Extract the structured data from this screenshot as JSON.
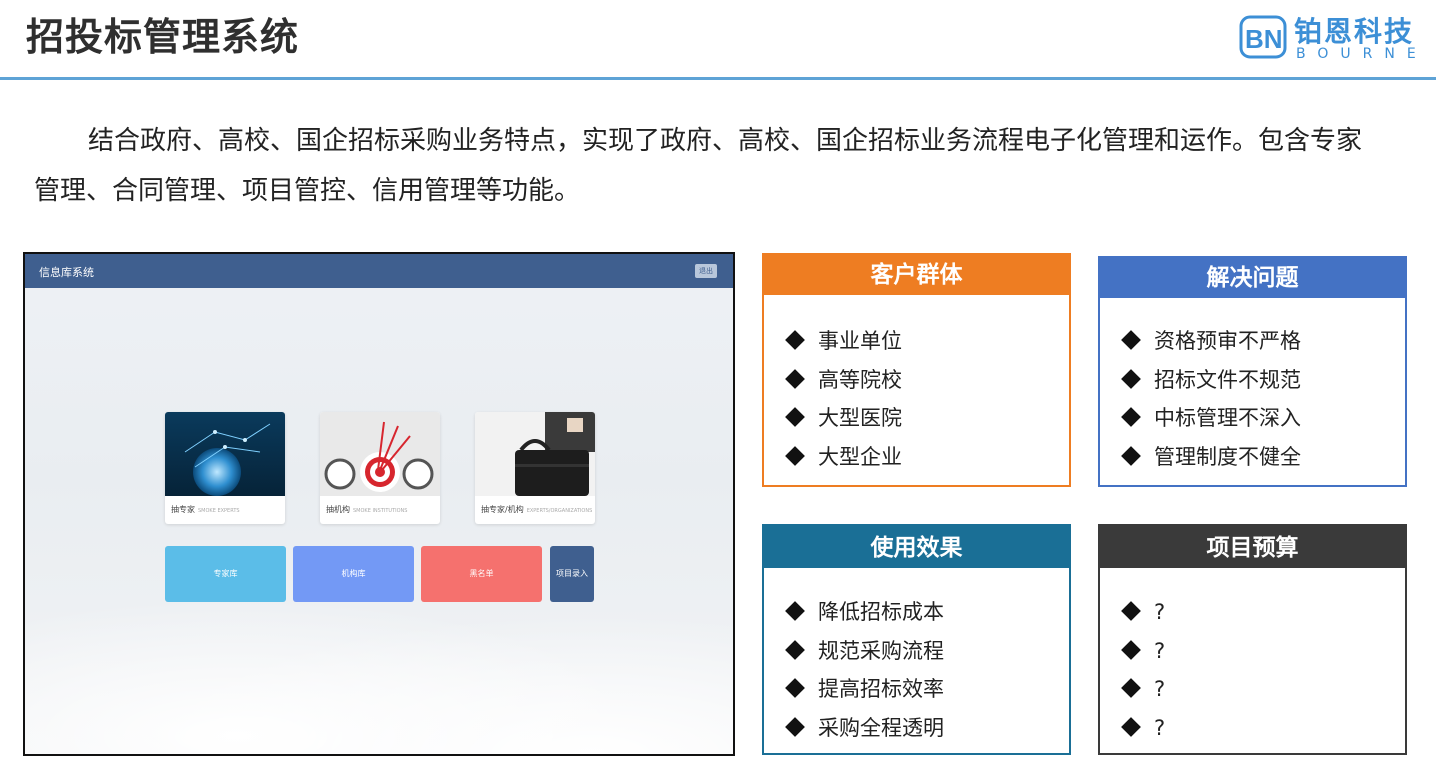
{
  "header": {
    "title": "招投标管理系统"
  },
  "logo": {
    "cn": "铂恩科技",
    "en": "BOURNE",
    "accent": "#3c8fd6"
  },
  "intro": "结合政府、高校、国企招标采购业务特点，实现了政府、高校、国企招标业务流程电子化管理和运作。包含专家管理、合同管理、项目管控、信用管理等功能。",
  "screenshot": {
    "title": "信息库系统",
    "logout_label": "退出",
    "cards": [
      {
        "label": "抽专家",
        "en": "SMOKE EXPERTS"
      },
      {
        "label": "抽机构",
        "en": "SMOKE INSTITUTIONS"
      },
      {
        "label": "抽专家/机构",
        "en": "EXPERTS/ORGANIZATIONS"
      }
    ],
    "tiles": [
      {
        "label": "专家库",
        "color": "#5bbde8"
      },
      {
        "label": "机构库",
        "color": "#7399f5"
      },
      {
        "label": "黑名单",
        "color": "#f5716e"
      },
      {
        "label": "项目录入",
        "color": "#3f5f8f"
      }
    ]
  },
  "panels": [
    {
      "id": "customers",
      "title": "客户群体",
      "color": "#ee7d22",
      "items": [
        "事业单位",
        "高等院校",
        "大型医院",
        "大型企业"
      ]
    },
    {
      "id": "problems",
      "title": "解决问题",
      "color": "#4472c4",
      "items": [
        "资格预审不严格",
        "招标文件不规范",
        "中标管理不深入",
        "管理制度不健全"
      ]
    },
    {
      "id": "effects",
      "title": "使用效果",
      "color": "#1a6f96",
      "items": [
        "降低招标成本",
        "规范采购流程",
        "提高招标效率",
        "采购全程透明"
      ]
    },
    {
      "id": "budget",
      "title": "项目预算",
      "color": "#3a3a3a",
      "items": [
        "?",
        "?",
        "?",
        "?"
      ]
    }
  ]
}
